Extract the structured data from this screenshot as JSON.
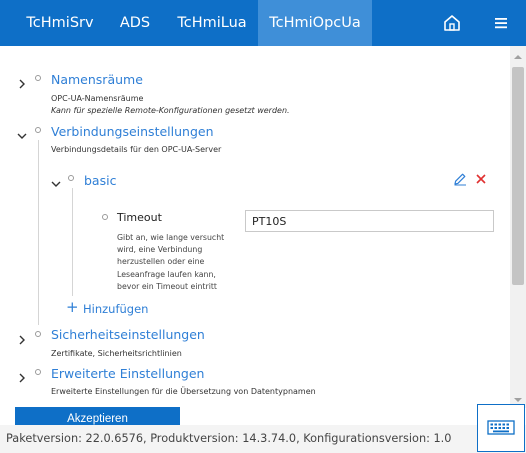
{
  "nav": {
    "tabs": [
      {
        "label": "TcHmiSrv",
        "active": false
      },
      {
        "label": "ADS",
        "active": false
      },
      {
        "label": "TcHmiLua",
        "active": false
      },
      {
        "label": "TcHmiOpcUa",
        "active": true
      }
    ],
    "home_icon": "home-icon",
    "menu_icon": "hamburger-menu-icon"
  },
  "tree": {
    "namespaces": {
      "title": "Namensräume",
      "desc1": "OPC-UA-Namensräume",
      "desc2": "Kann für spezielle Remote-Konfigurationen gesetzt werden.",
      "expanded": false
    },
    "connection": {
      "title": "Verbindungseinstellungen",
      "desc": "Verbindungsdetails für den OPC-UA-Server",
      "expanded": true,
      "item": {
        "title": "basic",
        "expanded": true,
        "field": {
          "label": "Timeout",
          "value": "PT10S",
          "help": [
            "Gibt an, wie lange versucht",
            "wird, eine Verbindung",
            "herzustellen oder eine",
            "Leseanfrage laufen kann,",
            "bevor ein Timeout eintritt"
          ]
        }
      },
      "add_label": "Hinzufügen"
    },
    "security": {
      "title": "Sicherheitseinstellungen",
      "desc": "Zertifikate, Sicherheitsrichtlinien",
      "expanded": false
    },
    "advanced": {
      "title": "Erweiterte Einstellungen",
      "desc": "Erweiterte Einstellungen für die Übersetzung von Datentypnamen",
      "expanded": false
    }
  },
  "actions": {
    "accept_label": "Akzeptieren"
  },
  "status": {
    "version_text": "Paketversion: 22.0.6576, Produktversion: 14.3.74.0, Konfigurationsversion: 1.0"
  },
  "colors": {
    "primary": "#0e6fc7",
    "active_tab": "#3f8fd8",
    "link": "#2f7fd6",
    "delete": "#e03030"
  }
}
